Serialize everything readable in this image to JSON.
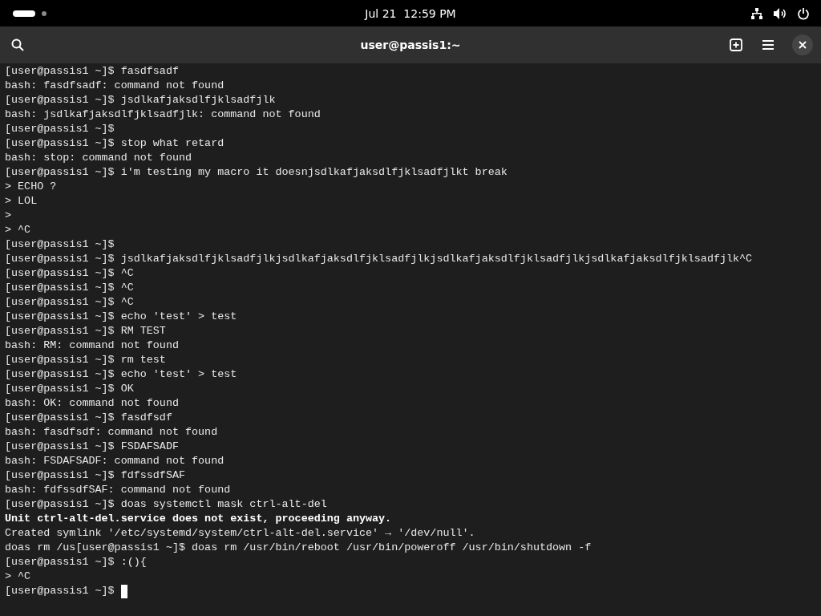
{
  "top_bar": {
    "clock": "Jul 21  12:59 PM"
  },
  "header_bar": {
    "title": "user@passis1:~"
  },
  "terminal": {
    "cursor": true,
    "lines": [
      {
        "text": "[user@passis1 ~]$ fasdfsadf",
        "bold": false
      },
      {
        "text": "bash: fasdfsadf: command not found",
        "bold": false
      },
      {
        "text": "[user@passis1 ~]$ jsdlkafjaksdlfjklsadfjlk",
        "bold": false
      },
      {
        "text": "bash: jsdlkafjaksdlfjklsadfjlk: command not found",
        "bold": false
      },
      {
        "text": "[user@passis1 ~]$",
        "bold": false
      },
      {
        "text": "[user@passis1 ~]$ stop what retard",
        "bold": false
      },
      {
        "text": "bash: stop: command not found",
        "bold": false
      },
      {
        "text": "[user@passis1 ~]$ i'm testing my macro it doesnjsdlkafjaksdlfjklsadfjlkt break",
        "bold": false
      },
      {
        "text": "> ECHO ?",
        "bold": false
      },
      {
        "text": "> LOL",
        "bold": false
      },
      {
        "text": ">",
        "bold": false
      },
      {
        "text": "> ^C",
        "bold": false
      },
      {
        "text": "[user@passis1 ~]$",
        "bold": false
      },
      {
        "text": "[user@passis1 ~]$ jsdlkafjaksdlfjklsadfjlkjsdlkafjaksdlfjklsadfjlkjsdlkafjaksdlfjklsadfjlkjsdlkafjaksdlfjklsadfjlk^C",
        "bold": false
      },
      {
        "text": "[user@passis1 ~]$ ^C",
        "bold": false
      },
      {
        "text": "[user@passis1 ~]$ ^C",
        "bold": false
      },
      {
        "text": "[user@passis1 ~]$ ^C",
        "bold": false
      },
      {
        "text": "[user@passis1 ~]$ echo 'test' > test",
        "bold": false
      },
      {
        "text": "[user@passis1 ~]$ RM TEST",
        "bold": false
      },
      {
        "text": "bash: RM: command not found",
        "bold": false
      },
      {
        "text": "[user@passis1 ~]$ rm test",
        "bold": false
      },
      {
        "text": "[user@passis1 ~]$ echo 'test' > test",
        "bold": false
      },
      {
        "text": "[user@passis1 ~]$ OK",
        "bold": false
      },
      {
        "text": "bash: OK: command not found",
        "bold": false
      },
      {
        "text": "[user@passis1 ~]$ fasdfsdf",
        "bold": false
      },
      {
        "text": "bash: fasdfsdf: command not found",
        "bold": false
      },
      {
        "text": "[user@passis1 ~]$ FSDAFSADF",
        "bold": false
      },
      {
        "text": "bash: FSDAFSADF: command not found",
        "bold": false
      },
      {
        "text": "[user@passis1 ~]$ fdfssdfSAF",
        "bold": false
      },
      {
        "text": "bash: fdfssdfSAF: command not found",
        "bold": false
      },
      {
        "text": "[user@passis1 ~]$ doas systemctl mask ctrl-alt-del",
        "bold": false
      },
      {
        "text": "Unit ctrl-alt-del.service does not exist, proceeding anyway.",
        "bold": true
      },
      {
        "text": "Created symlink '/etc/systemd/system/ctrl-alt-del.service' → '/dev/null'.",
        "bold": false
      },
      {
        "text": "doas rm /us[user@passis1 ~]$ doas rm /usr/bin/reboot /usr/bin/poweroff /usr/bin/shutdown -f",
        "bold": false
      },
      {
        "text": "[user@passis1 ~]$ :(){",
        "bold": false
      },
      {
        "text": "> ^C",
        "bold": false
      },
      {
        "text": "[user@passis1 ~]$",
        "bold": false
      }
    ]
  }
}
